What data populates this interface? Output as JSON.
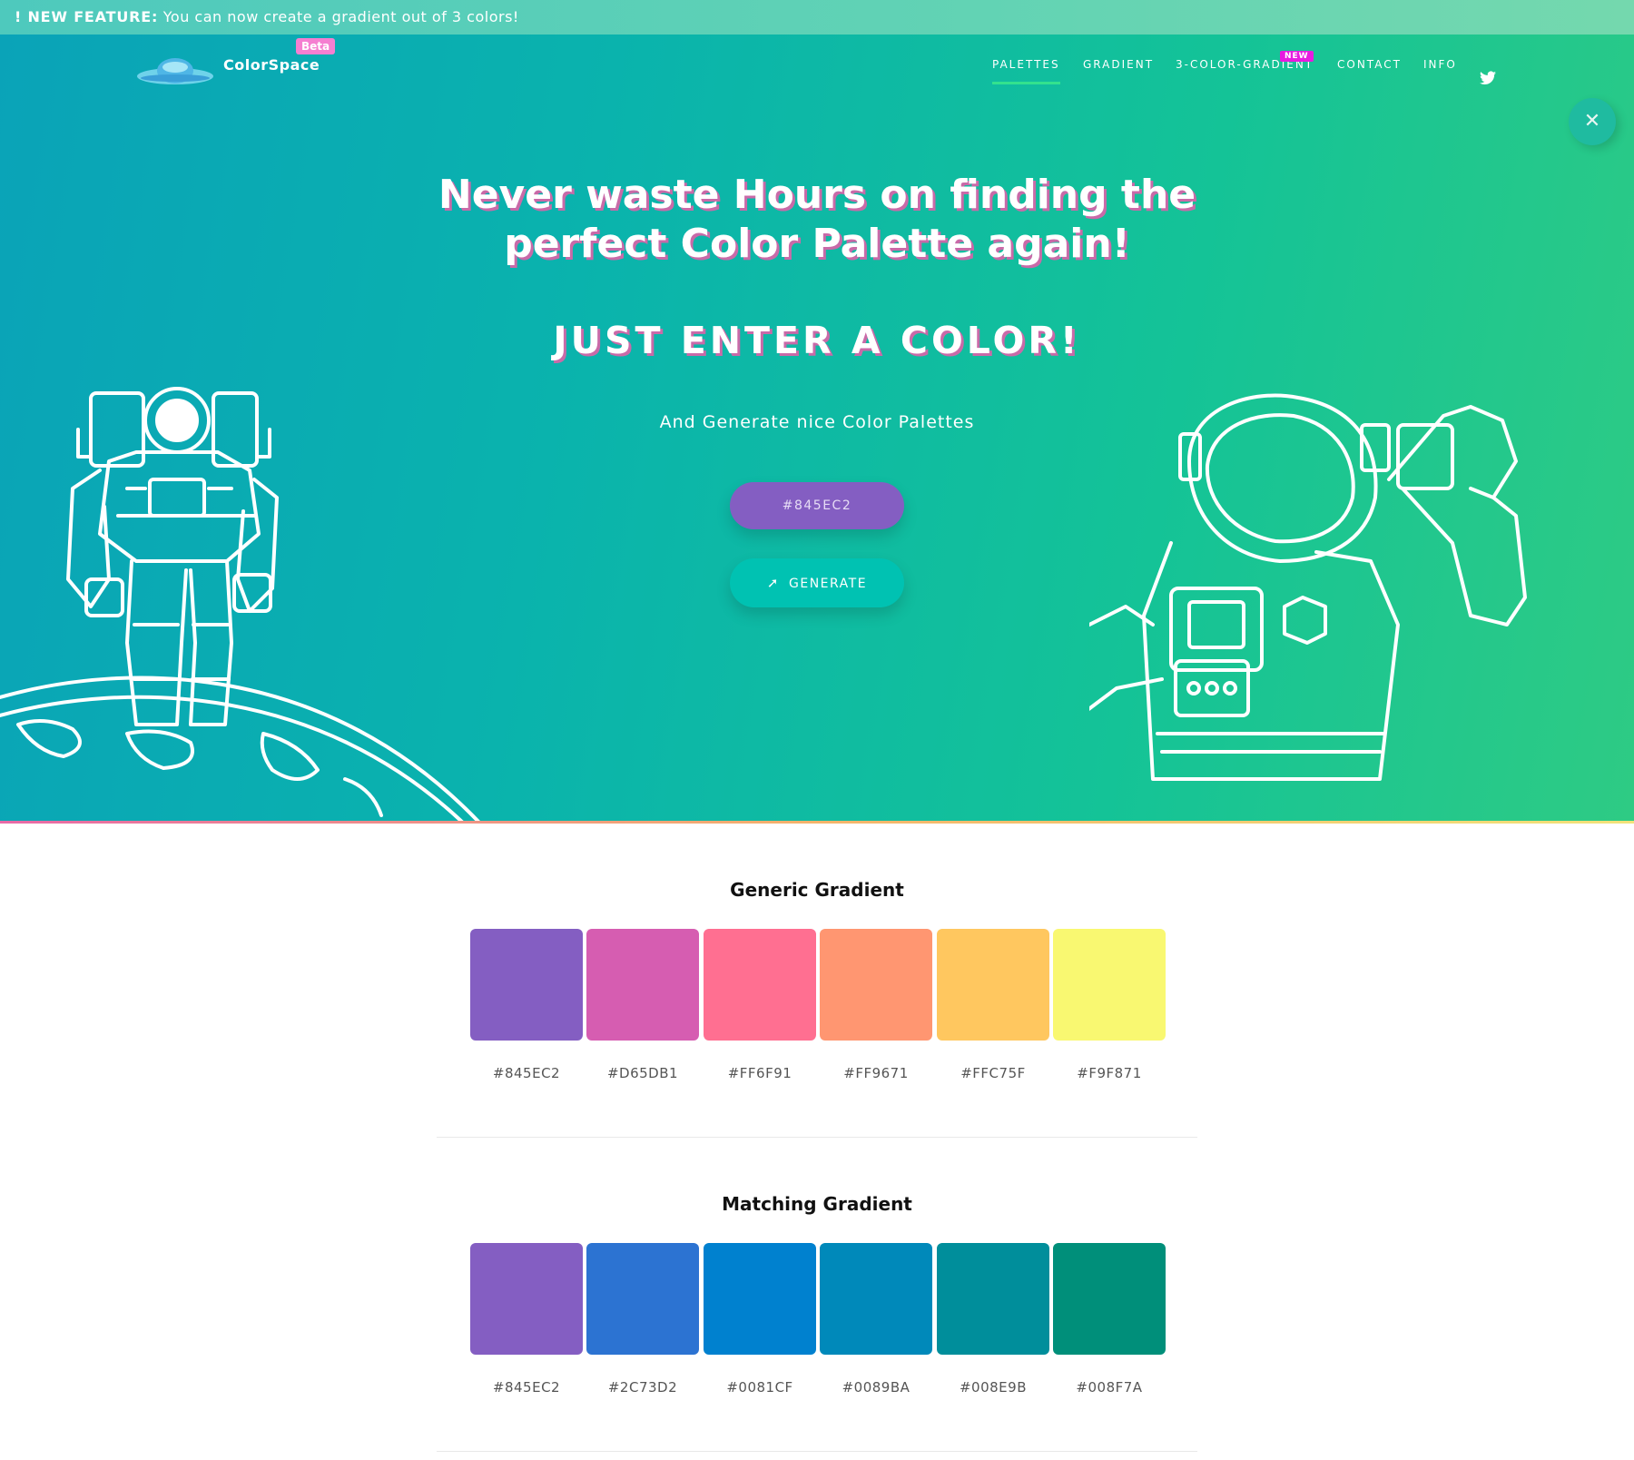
{
  "announcement": {
    "prefix": "! NEW FEATURE:",
    "text": "You can now create a gradient out of 3 colors!"
  },
  "brand": {
    "name": "ColorSpace",
    "badge": "Beta",
    "logo_icon": "planet-ufo-icon"
  },
  "nav": {
    "items": [
      {
        "label": "PALETTES",
        "active": true
      },
      {
        "label": "GRADIENT",
        "active": false
      },
      {
        "label": "3-COLOR-GRADIENT",
        "active": false,
        "badge": "NEW"
      },
      {
        "label": "CONTACT",
        "active": false
      },
      {
        "label": "INFO",
        "active": false
      }
    ],
    "social_icon": "twitter-icon"
  },
  "close_icon": "close-icon",
  "hero": {
    "headline": "Never waste Hours on finding the perfect Color Palette again!",
    "subhead": "JUST ENTER A COLOR!",
    "tagline": "And Generate nice Color Palettes",
    "input_value": "#845EC2",
    "generate_label": "GENERATE",
    "generate_icon": "rocket-icon"
  },
  "colors": {
    "hero_start": "#0aa3b8",
    "hero_end": "#2ecb84",
    "accent": "#845ec2",
    "button": "#00c2b2",
    "active_underline": "#33e28e",
    "beta_badge": "#f57fd1",
    "new_badge": "#e71be0"
  },
  "palettes": [
    {
      "title": "Generic Gradient",
      "swatches": [
        "#845EC2",
        "#D65DB1",
        "#FF6F91",
        "#FF9671",
        "#FFC75F",
        "#F9F871"
      ]
    },
    {
      "title": "Matching Gradient",
      "swatches": [
        "#845EC2",
        "#2C73D2",
        "#0081CF",
        "#0089BA",
        "#008E9B",
        "#008F7A"
      ]
    }
  ]
}
